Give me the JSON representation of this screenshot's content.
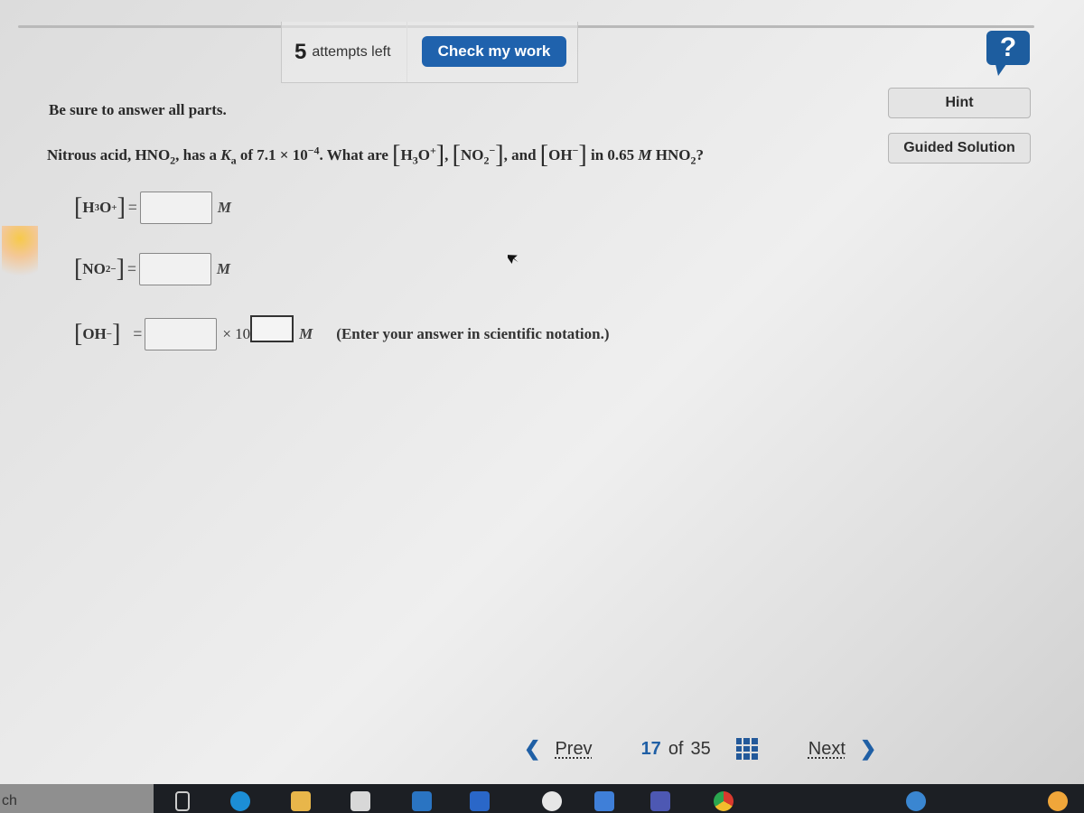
{
  "header": {
    "attempts_count": "5",
    "attempts_label": "attempts left",
    "check_button": "Check my work",
    "help_icon": "?"
  },
  "side_buttons": {
    "hint": "Hint",
    "guided_solution": "Guided Solution"
  },
  "question": {
    "instructions": "Be sure to answer all parts.",
    "text_prefix": "Nitrous acid, HNO",
    "text_sub2": "2",
    "text_has": ", has a ",
    "ka_symbol": "K",
    "ka_sub": "a",
    "text_of": " of 7.1 × 10",
    "exponent": "−4",
    "text_what": ". What are ",
    "h3o_label": "H",
    "h3o_sub": "3",
    "h3o_o": "O",
    "h3o_sup": "+",
    "no2_label": "NO",
    "no2_sub": "2",
    "no2_sup": "−",
    "and": ", and ",
    "oh_label": "OH",
    "oh_sup": "−",
    "text_in": " in 0.65 ",
    "molar": "M",
    "text_hno2": " HNO",
    "text_hno2_sub": "2",
    "text_end": "?"
  },
  "answers": {
    "h3o": {
      "label": "H",
      "sub": "3",
      "o": "O",
      "sup": "+",
      "value": "",
      "unit": "M"
    },
    "no2": {
      "label": "NO",
      "sub": "2",
      "sup": "−",
      "value": "",
      "unit": "M"
    },
    "oh": {
      "label": "OH",
      "sup": "−",
      "value": "",
      "times": "× 10",
      "exponent_value": "",
      "unit": "M",
      "note": "(Enter your answer in scientific notation.)"
    },
    "equals": "="
  },
  "navigation": {
    "prev": "Prev",
    "current_page": "17",
    "of": "of",
    "total_pages": "35",
    "next": "Next"
  },
  "taskbar": {
    "search_text": "ch"
  }
}
